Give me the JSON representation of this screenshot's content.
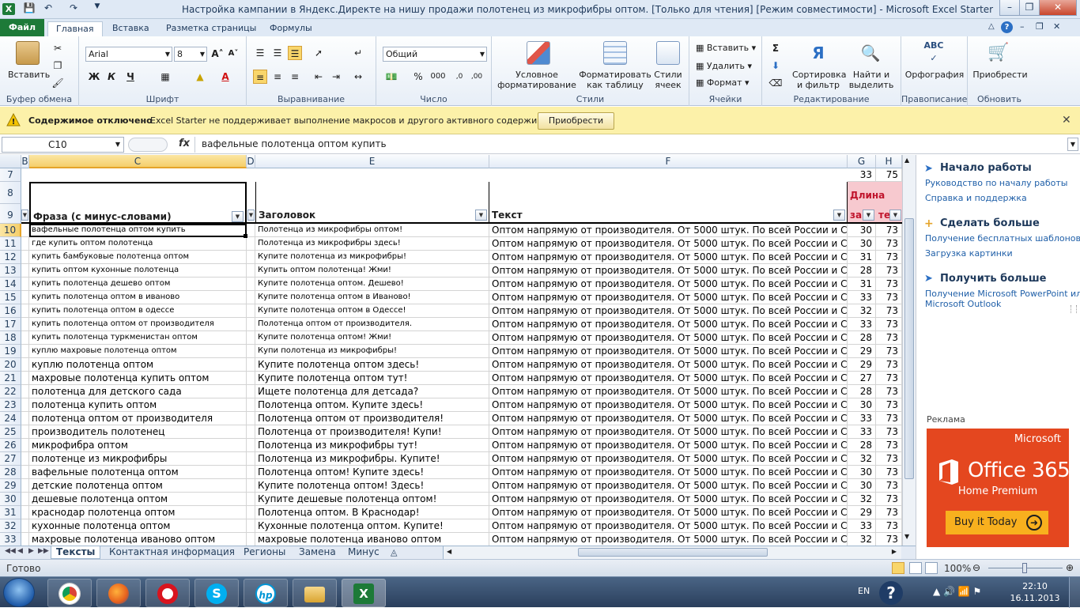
{
  "window": {
    "title": "Настройка кампании в Яндекс.Директе на нишу продажи полотенец из микрофибры оптом.  [Только для чтения]  [Режим совместимости]  -  Microsoft Excel Starter"
  },
  "tabs": {
    "file": "Файл",
    "items": [
      "Главная",
      "Вставка",
      "Разметка страницы",
      "Формулы"
    ]
  },
  "ribbon": {
    "clipboard": {
      "label": "Буфер обмена",
      "paste": "Вставить"
    },
    "font": {
      "label": "Шрифт",
      "name": "Arial",
      "size": "8",
      "bold": "Ж",
      "italic": "К",
      "underline": "Ч"
    },
    "alignment": {
      "label": "Выравнивание"
    },
    "number": {
      "label": "Число",
      "format": "Общий",
      "percent": "%",
      "thousands": "000"
    },
    "styles": {
      "label": "Стили",
      "cond1": "Условное",
      "cond2": "форматирование",
      "table1": "Форматировать",
      "table2": "как таблицу",
      "cell1": "Стили",
      "cell2": "ячеек"
    },
    "cells": {
      "label": "Ячейки",
      "insert": "Вставить",
      "delete": "Удалить",
      "format": "Формат"
    },
    "editing": {
      "label": "Редактирование",
      "sort1": "Сортировка",
      "sort2": "и фильтр",
      "find1": "Найти и",
      "find2": "выделить"
    },
    "proofing": {
      "label": "Правописание",
      "spell": "Орфография"
    },
    "update": {
      "label": "Обновить",
      "buy": "Приобрести"
    }
  },
  "message_bar": {
    "title": "Содержимое отключено",
    "text": "Excel Starter не поддерживает выполнение макросов и другого активного содержимого.",
    "button": "Приобрести"
  },
  "formula_bar": {
    "name_box": "C10",
    "fx": "fx",
    "value": "вафельные полотенца оптом купить"
  },
  "grid": {
    "columns": [
      "B",
      "C",
      "D",
      "E",
      "F",
      "G",
      "H"
    ],
    "row7": {
      "num": "7",
      "g": "33",
      "h": "75"
    },
    "header_rows": [
      "8",
      "9"
    ],
    "headers": {
      "c": "Фраза (с минус-словами)",
      "e": "Заголовок",
      "f": "Текст",
      "g_top": "Длина",
      "g_bottom": "за",
      "h_bottom": "те"
    },
    "rows": [
      {
        "n": "10",
        "c": "вафельные полотенца оптом купить",
        "e": "Полотенца из микрофибры оптом!",
        "f": "Оптом напрямую от производителя. От 5000 штук. По всей России и СНГ.",
        "g": "30",
        "h": "73",
        "small": true
      },
      {
        "n": "11",
        "c": "где купить оптом полотенца",
        "e": "Полотенца из микрофибры здесь!",
        "f": "Оптом напрямую от производителя. От 5000 штук. По всей России и СНГ.",
        "g": "30",
        "h": "73",
        "small": true
      },
      {
        "n": "12",
        "c": "купить бамбуковые полотенца оптом",
        "e": "Купите полотенца из микрофибры!",
        "f": "Оптом напрямую от производителя. От 5000 штук. По всей России и СНГ.",
        "g": "31",
        "h": "73",
        "small": true
      },
      {
        "n": "13",
        "c": "купить оптом кухонные полотенца",
        "e": "Купить оптом полотенца! Жми!",
        "f": "Оптом напрямую от производителя. От 5000 штук. По всей России и СНГ.",
        "g": "28",
        "h": "73",
        "small": true
      },
      {
        "n": "14",
        "c": "купить полотенца дешево оптом",
        "e": "Купите полотенца оптом. Дешево!",
        "f": "Оптом напрямую от производителя. От 5000 штук. По всей России и СНГ.",
        "g": "31",
        "h": "73",
        "small": true
      },
      {
        "n": "15",
        "c": "купить полотенца оптом в иваново",
        "e": "Купите полотенца оптом в Иваново!",
        "f": "Оптом напрямую от производителя. От 5000 штук. По всей России и СНГ.",
        "g": "33",
        "h": "73",
        "small": true
      },
      {
        "n": "16",
        "c": "купить полотенца оптом в одессе",
        "e": "Купите полотенца оптом в Одессе!",
        "f": "Оптом напрямую от производителя. От 5000 штук. По всей России и СНГ.",
        "g": "32",
        "h": "73",
        "small": true
      },
      {
        "n": "17",
        "c": "купить полотенца оптом от производителя",
        "e": "Полотенца оптом от производителя.",
        "f": "Оптом напрямую от производителя. От 5000 штук. По всей России и СНГ.",
        "g": "33",
        "h": "73",
        "small": true
      },
      {
        "n": "18",
        "c": "купить полотенца туркменистан оптом",
        "e": "Купите полотенца оптом! Жми!",
        "f": "Оптом напрямую от производителя. От 5000 штук. По всей России и СНГ.",
        "g": "28",
        "h": "73",
        "small": true
      },
      {
        "n": "19",
        "c": "куплю махровые полотенца оптом",
        "e": "Купи полотенца из микрофибры!",
        "f": "Оптом напрямую от производителя. От 5000 штук. По всей России и СНГ.",
        "g": "29",
        "h": "73",
        "small": true
      },
      {
        "n": "20",
        "c": "куплю полотенца оптом",
        "e": "Купите полотенца оптом здесь!",
        "f": "Оптом напрямую от производителя. От 5000 штук. По всей России и СНГ.",
        "g": "29",
        "h": "73",
        "small": false
      },
      {
        "n": "21",
        "c": "махровые полотенца купить оптом",
        "e": "Купите полотенца оптом тут!",
        "f": "Оптом напрямую от производителя. От 5000 штук. По всей России и СНГ.",
        "g": "27",
        "h": "73",
        "small": false
      },
      {
        "n": "22",
        "c": "полотенца для детского сада",
        "e": "Ищете полотенца для детсада?",
        "f": "Оптом напрямую от производителя. От 5000 штук. По всей России и СНГ.",
        "g": "28",
        "h": "73",
        "small": false
      },
      {
        "n": "23",
        "c": "полотенца купить оптом",
        "e": "Полотенца оптом. Купите здесь!",
        "f": "Оптом напрямую от производителя. От 5000 штук. По всей России и СНГ.",
        "g": "30",
        "h": "73",
        "small": false
      },
      {
        "n": "24",
        "c": "полотенца оптом от производителя",
        "e": "Полотенца оптом от производителя!",
        "f": "Оптом напрямую от производителя. От 5000 штук. По всей России и СНГ.",
        "g": "33",
        "h": "73",
        "small": false
      },
      {
        "n": "25",
        "c": "производитель полотенец",
        "e": "Полотенца от производителя! Купи!",
        "f": "Оптом напрямую от производителя. От 5000 штук. По всей России и СНГ.",
        "g": "33",
        "h": "73",
        "small": false
      },
      {
        "n": "26",
        "c": "микрофибра оптом",
        "e": "Полотенца из микрофибры тут!",
        "f": "Оптом напрямую от производителя. От 5000 штук. По всей России и СНГ.",
        "g": "28",
        "h": "73",
        "small": false
      },
      {
        "n": "27",
        "c": "полотенце из микрофибры",
        "e": "Полотенца из микрофибры. Купите!",
        "f": "Оптом напрямую от производителя. От 5000 штук. По всей России и СНГ.",
        "g": "32",
        "h": "73",
        "small": false
      },
      {
        "n": "28",
        "c": "вафельные полотенца оптом",
        "e": "Полотенца оптом! Купите здесь!",
        "f": "Оптом напрямую от производителя. От 5000 штук. По всей России и СНГ.",
        "g": "30",
        "h": "73",
        "small": false
      },
      {
        "n": "29",
        "c": "детские полотенца оптом",
        "e": "Купите полотенца оптом! Здесь!",
        "f": "Оптом напрямую от производителя. От 5000 штук. По всей России и СНГ.",
        "g": "30",
        "h": "73",
        "small": false
      },
      {
        "n": "30",
        "c": "дешевые полотенца оптом",
        "e": "Купите дешевые полотенца оптом!",
        "f": "Оптом напрямую от производителя. От 5000 штук. По всей России и СНГ.",
        "g": "32",
        "h": "73",
        "small": false
      },
      {
        "n": "31",
        "c": "краснодар полотенца оптом",
        "e": "Полотенца оптом. В Краснодар!",
        "f": "Оптом напрямую от производителя. От 5000 штук. По всей России и СНГ.",
        "g": "29",
        "h": "73",
        "small": false
      },
      {
        "n": "32",
        "c": "кухонные полотенца оптом",
        "e": "Кухонные полотенца оптом. Купите!",
        "f": "Оптом напрямую от производителя. От 5000 штук. По всей России и СНГ.",
        "g": "33",
        "h": "73",
        "small": false
      },
      {
        "n": "33",
        "c": "махровые полотенца иваново оптом",
        "e": "махровые полотенца иваново оптом",
        "f": "Оптом напрямую от производителя. От 5000 штук. По всей России и СНГ.",
        "g": "32",
        "h": "73",
        "small": false
      }
    ]
  },
  "sheets": [
    "Тексты",
    "Контактная информация",
    "Регионы",
    "Замена",
    "Минус"
  ],
  "task_pane": {
    "getting_started": "Начало работы",
    "gs_links": [
      "Руководство по началу работы",
      "Справка и поддержка"
    ],
    "do_more": "Сделать больше",
    "dm_links": [
      "Получение бесплатных шаблонов",
      "Загрузка картинки"
    ],
    "get_more": "Получить больше",
    "gm_links": [
      "Получение Microsoft PowerPoint или",
      "Microsoft Outlook"
    ],
    "ad_label": "Реклама",
    "ad": {
      "brand": "Microsoft",
      "product": "Office 365",
      "edition": "Home Premium",
      "cta": "Buy it Today"
    }
  },
  "status": {
    "ready": "Готово",
    "zoom": "100%"
  },
  "taskbar": {
    "lang": "EN",
    "time": "22:10",
    "date": "16.11.2013"
  },
  "colors": {
    "excel_green": "#1d7a38",
    "selection_orange": "#f5cf6b",
    "header_pink": "#f7c9cf",
    "ad_orange": "#e4471f"
  }
}
